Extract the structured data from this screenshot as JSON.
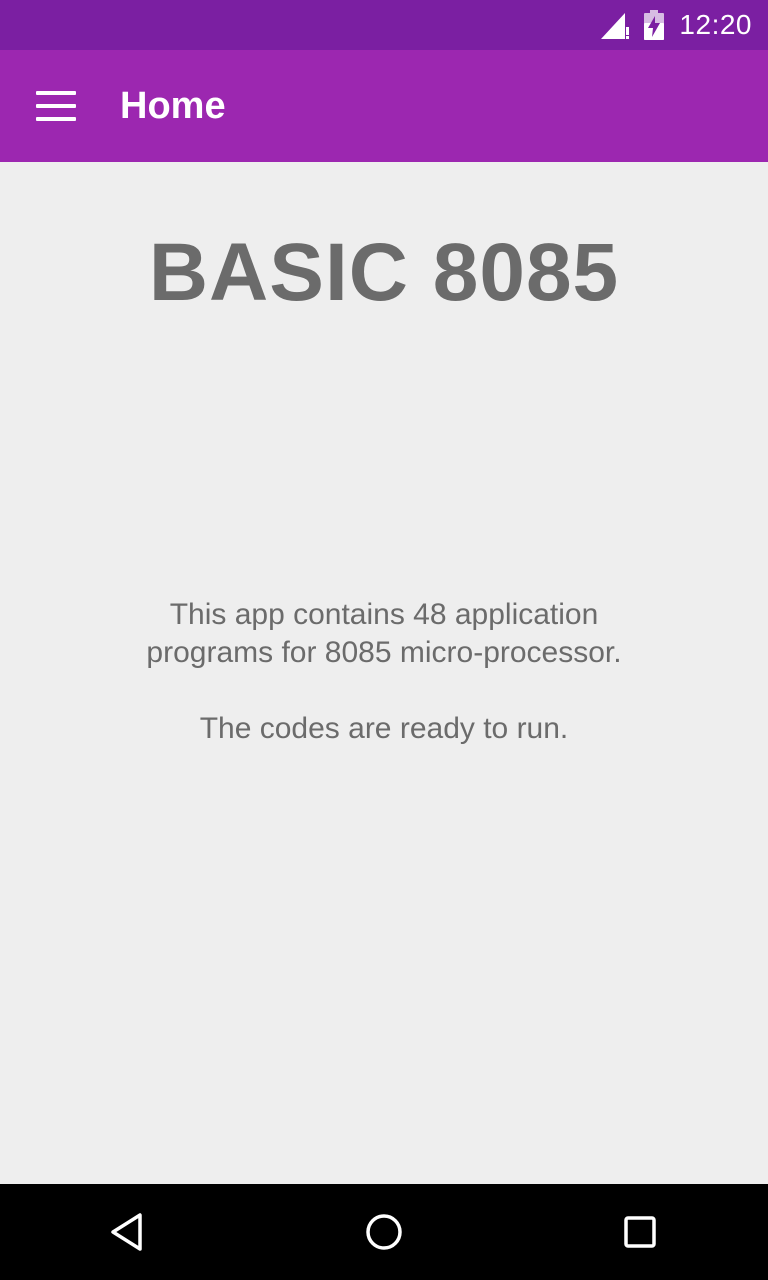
{
  "status_bar": {
    "time": "12:20",
    "icons": [
      "signal-icon",
      "battery-charging-icon"
    ]
  },
  "toolbar": {
    "menu_icon": "menu-icon",
    "title": "Home"
  },
  "main": {
    "heading": "BASIC 8085",
    "description_line1": "This app contains 48 application",
    "description_line2": "programs for 8085 micro-processor.",
    "description_line3": "The codes are ready to run."
  },
  "nav_bar": {
    "icons": [
      "back-icon",
      "home-icon",
      "recents-icon"
    ]
  },
  "colors": {
    "status_bar": "#7b1fa2",
    "toolbar": "#9c27b0",
    "background": "#eeeeee",
    "text": "#6b6b6b",
    "nav_bar": "#000000"
  }
}
